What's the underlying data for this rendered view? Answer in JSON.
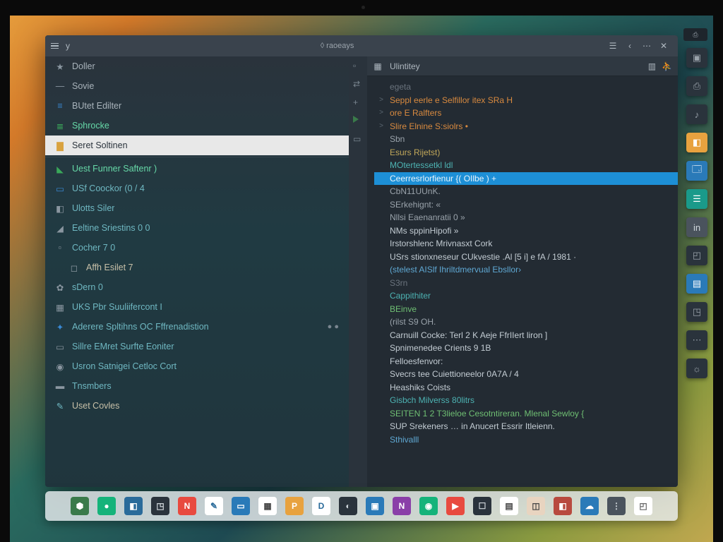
{
  "titlebar": {
    "app_hint": "y",
    "center": "◊  raoeays",
    "right_icons": [
      "menu",
      "min",
      "close"
    ]
  },
  "sidebar": {
    "items": [
      {
        "icon": "star",
        "label": "Doller",
        "group": "g1"
      },
      {
        "icon": "dash",
        "label": "Sovie",
        "group": "g1"
      },
      {
        "icon": "bars-blue",
        "label": "BUtet Edilter",
        "group": "g1"
      },
      {
        "icon": "bars-green",
        "label": "Sphrocke",
        "group": "g2"
      },
      {
        "icon": "folder-y",
        "label": "Seret Soltinen",
        "group": "hl"
      },
      {
        "icon": "sep"
      },
      {
        "icon": "tag-g",
        "label": "Uest Funner Saftenr )",
        "group": "g2",
        "right": ""
      },
      {
        "icon": "page-b",
        "label": "USf Coockor (0 / 4",
        "group": "g3"
      },
      {
        "icon": "cube-g",
        "label": "Ulotts Siler",
        "group": "g3"
      },
      {
        "icon": "chart",
        "label": "Eeltine Sriestins 0 0",
        "group": "g3"
      },
      {
        "icon": "doc",
        "label": "Cocher 7  0",
        "group": "g3"
      },
      {
        "icon": "sq",
        "label": "Affh  Esilet 7",
        "group": "g4",
        "indent": true
      },
      {
        "icon": "cog",
        "label": "sDern 0",
        "group": "g3"
      },
      {
        "icon": "grid",
        "label": "UKS Pbr Suuliifercont I",
        "group": "g3"
      },
      {
        "icon": "spark",
        "label": "Aderere Spltihns OC Fffrenadistion",
        "group": "g3",
        "right": "● ●"
      },
      {
        "icon": "page-t",
        "label": "Sillre EMret Surfte Eoniter",
        "group": "g3"
      },
      {
        "icon": "avatar",
        "label": "Usron Satnigei Cetloc Cort",
        "group": "g3"
      },
      {
        "icon": "book",
        "label": "Tnsmbers",
        "group": "g3"
      },
      {
        "icon": "pencil",
        "label": "Uset  Covles",
        "group": "g4"
      }
    ]
  },
  "gutter_icons": [
    "page",
    "code",
    "plus",
    "play",
    "page"
  ],
  "editor": {
    "tab_title": "Ulintitey",
    "subtitle": "egeta",
    "right_icons": [
      "grid",
      "person"
    ],
    "lines": [
      {
        "i": ">",
        "cls": "c-o",
        "t": "Seppl eerle e Selfillor itex SRa H"
      },
      {
        "i": ">",
        "cls": "c-o",
        "t": "ore E Ralfters"
      },
      {
        "i": ">",
        "cls": "c-o",
        "t": "Slire Elnine S:siolrs  •"
      },
      {
        "i": "",
        "cls": "c-g",
        "t": "Sbn"
      },
      {
        "i": "",
        "cls": "c-y",
        "t": "Esurs Rijetst)"
      },
      {
        "i": "",
        "cls": "c-t",
        "t": "MOtertessetkl ldl"
      },
      {
        "i": "",
        "cls": "sel",
        "t": "Ceerresrlorfienur {( OIlbe ) +"
      },
      {
        "i": "",
        "cls": "c-g",
        "t": "CbN11UUnK."
      },
      {
        "i": "",
        "cls": "c-g",
        "t": "SErkehignt: «"
      },
      {
        "i": "",
        "cls": "c-g",
        "t": "Nllsi Eaenanratii 0  »"
      },
      {
        "i": "",
        "cls": "c-w",
        "t": "NMs sppinHipofi »"
      },
      {
        "i": "",
        "cls": "c-w",
        "t": "Irstorshlenc Mrivnasxt  Cork"
      },
      {
        "i": "",
        "cls": "c-w",
        "t": "USrs stionxneseur CUkvestie .Al [5 i]    e fA /  1981 ·"
      },
      {
        "i": "",
        "cls": "c-b",
        "t": "(stelest  AISlf Ihriltdmervual Ebsllor›"
      },
      {
        "i": "",
        "cls": "c-d",
        "t": "S3rn"
      },
      {
        "i": "",
        "cls": "c-t",
        "t": "Cappithiter"
      },
      {
        "i": "",
        "cls": "c-gr",
        "t": "BEinve"
      },
      {
        "i": "",
        "cls": "c-g",
        "t": "(rilst  S9 OH."
      },
      {
        "i": "",
        "cls": "c-w",
        "t": "Carnuill Cocke: Terl 2 K    Aeje FfrIIert liron ]"
      },
      {
        "i": "",
        "cls": "c-w",
        "t": "Spnimenedee  Crients 9 1B"
      },
      {
        "i": "",
        "cls": "c-w",
        "t": "Felloesfenvor:"
      },
      {
        "i": "",
        "cls": "c-w",
        "t": "Svecrs  tee  Cuiettioneelor 0A7A /  4"
      },
      {
        "i": "",
        "cls": "c-w",
        "t": "Heashiks  Coists"
      },
      {
        "i": "",
        "cls": "c-t",
        "t": "Gisbch Milverss 80litrs"
      },
      {
        "i": "",
        "cls": "c-gr",
        "t": "SEITEN 1 2  T3lieloe Cesotntireran. Mlenal Sewloy {"
      },
      {
        "i": "",
        "cls": "c-w",
        "t": "SUP Srekeners … in Anucert Essrir Itleienn."
      },
      {
        "i": "",
        "cls": "c-b",
        "t": "Sthivalll"
      }
    ]
  },
  "widgets": [
    {
      "c": "dk",
      "g": "▣"
    },
    {
      "c": "dk",
      "g": "⎙"
    },
    {
      "c": "dk",
      "g": "♪"
    },
    {
      "c": "or",
      "g": "◧"
    },
    {
      "c": "bl",
      "g": "🗔"
    },
    {
      "c": "te",
      "g": "☰"
    },
    {
      "c": "gr",
      "g": "in"
    },
    {
      "c": "dk",
      "g": "◰"
    },
    {
      "c": "bl",
      "g": "▤"
    },
    {
      "c": "dk",
      "g": "◳"
    },
    {
      "c": "dk",
      "g": "⋯"
    },
    {
      "c": "dk",
      "g": "☼"
    }
  ],
  "taskbar": [
    {
      "bg": "#3a7a4a",
      "fg": "#fff",
      "g": "⬢"
    },
    {
      "bg": "#15b37a",
      "fg": "#fff",
      "g": "●"
    },
    {
      "bg": "#2a6b9a",
      "fg": "#fff",
      "g": "◧"
    },
    {
      "bg": "#2a333c",
      "fg": "#cfd6db",
      "g": "◳"
    },
    {
      "bg": "#e84a3f",
      "fg": "#fff",
      "g": "N"
    },
    {
      "bg": "#ffffff",
      "fg": "#2a6b9a",
      "g": "✎"
    },
    {
      "bg": "#2a7ab8",
      "fg": "#fff",
      "g": "▭"
    },
    {
      "bg": "#ffffff",
      "fg": "#444",
      "g": "▦"
    },
    {
      "bg": "#e8a23f",
      "fg": "#fff",
      "g": "P"
    },
    {
      "bg": "#ffffff",
      "fg": "#2a6b9a",
      "g": "D"
    },
    {
      "bg": "#2a333c",
      "fg": "#cfd6db",
      "g": "◐"
    },
    {
      "bg": "#2a7ab8",
      "fg": "#fff",
      "g": "▣"
    },
    {
      "bg": "#8a3fa8",
      "fg": "#fff",
      "g": "N"
    },
    {
      "bg": "#15b37a",
      "fg": "#fff",
      "g": "◉"
    },
    {
      "bg": "#e84a3f",
      "fg": "#fff",
      "g": "▶"
    },
    {
      "bg": "#2a333c",
      "fg": "#cfd6db",
      "g": "☐"
    },
    {
      "bg": "#ffffff",
      "fg": "#444",
      "g": "▤"
    },
    {
      "bg": "#e8d4c0",
      "fg": "#444",
      "g": "◫"
    },
    {
      "bg": "#b84a3f",
      "fg": "#fff",
      "g": "◧"
    },
    {
      "bg": "#2a7ab8",
      "fg": "#fff",
      "g": "☁"
    },
    {
      "bg": "#4a535d",
      "fg": "#cfd6db",
      "g": "⋮"
    },
    {
      "bg": "#ffffff",
      "fg": "#666",
      "g": "◰"
    }
  ]
}
